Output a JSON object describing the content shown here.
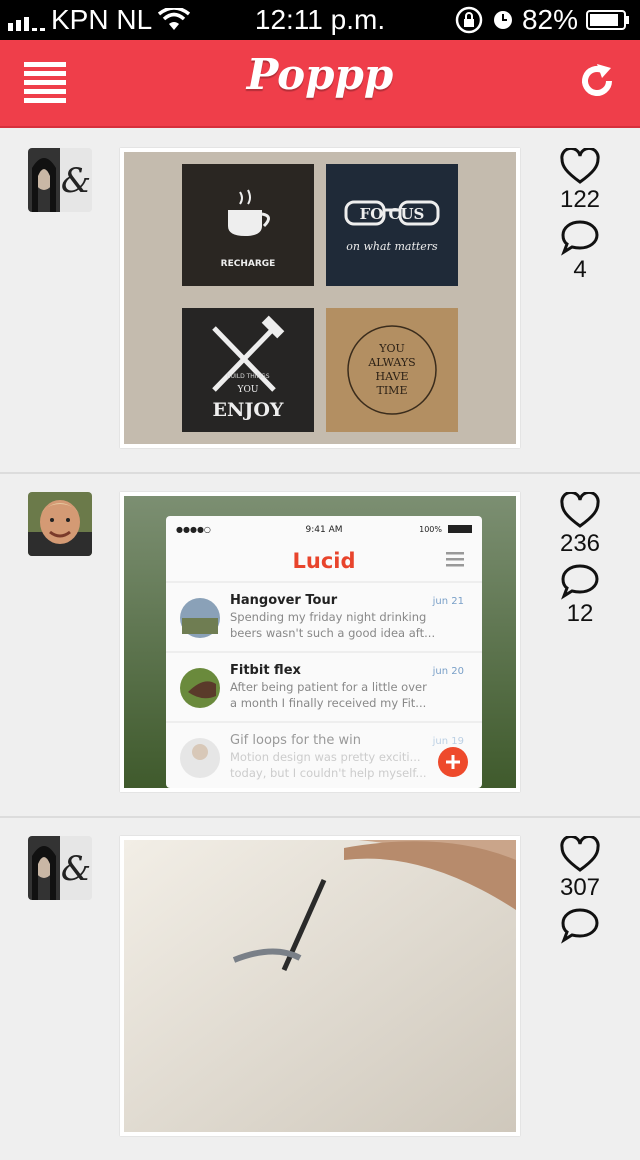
{
  "status_bar": {
    "carrier": "KPN NL",
    "time": "12:11 p.m.",
    "battery": "82%"
  },
  "nav": {
    "title": "Poppp"
  },
  "posts": [
    {
      "avatar": "avatar-ampersand",
      "likes": "122",
      "comments": "4",
      "photo": {
        "recharge": "RECHARGE",
        "focus": "FO  CUS",
        "focus_sub": "on what matters",
        "build": "BUILD THINGS",
        "you": "YOU",
        "enjoy": "ENJOY",
        "you_always": "YOU",
        "always": "ALWAYS",
        "have": "HAVE",
        "time": "TIME"
      }
    },
    {
      "avatar": "avatar-man",
      "likes": "236",
      "comments": "12",
      "photo": {
        "phone_time": "9:41 AM",
        "phone_battery": "100%",
        "app_title": "Lucid",
        "items": [
          {
            "title": "Hangover Tour",
            "date": "jun 21",
            "line1": "Spending my friday night drinking",
            "line2": "beers wasn't such a good idea aft..."
          },
          {
            "title": "Fitbit flex",
            "date": "jun 20",
            "line1": "After being patient for a little over",
            "line2": "a month I finally received my Fit..."
          },
          {
            "title": "Gif loops for the win",
            "date": "jun 19",
            "line1": "Motion design was pretty exciti...",
            "line2": "today, but I couldn't help myself..."
          }
        ]
      }
    },
    {
      "avatar": "avatar-ampersand",
      "likes": "307",
      "comments": "",
      "photo": {}
    }
  ]
}
